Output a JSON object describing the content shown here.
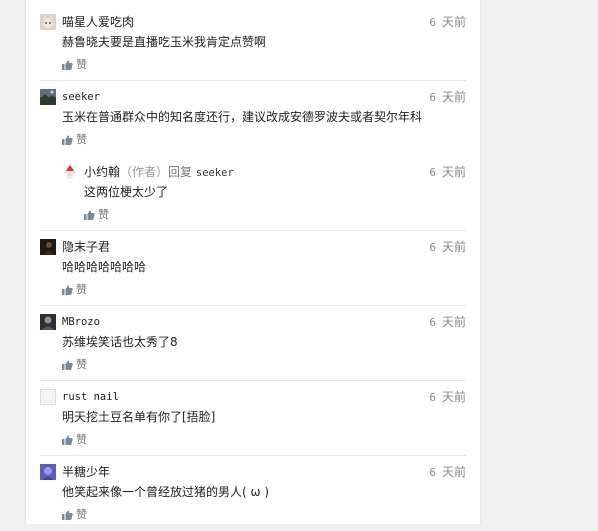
{
  "comments": [
    {
      "name": "喵星人爱吃肉",
      "time_num": "6",
      "time_unit": "天前",
      "text": "赫鲁晓夫要是直播吃玉米我肯定点赞啊",
      "like_label": "赞",
      "avatar_icon": "cat-avatar-icon"
    },
    {
      "name": "seeker",
      "time_num": "6",
      "time_unit": "天前",
      "text": "玉米在普通群众中的知名度还行，建议改成安德罗波夫或者契尔年科",
      "like_label": "赞",
      "avatar_icon": "landscape-avatar-icon"
    },
    {
      "name": "小约翰",
      "role": "（作者）",
      "reply_word": "回复",
      "reply_target": "seeker",
      "time_num": "6",
      "time_unit": "天前",
      "text": "这两位梗太少了",
      "like_label": "赞",
      "avatar_icon": "santa-avatar-icon"
    },
    {
      "name": "隐末子君",
      "time_num": "6",
      "time_unit": "天前",
      "text": "哈哈哈哈哈哈哈",
      "like_label": "赞",
      "avatar_icon": "dark-avatar-icon"
    },
    {
      "name": "MBrozo",
      "time_num": "6",
      "time_unit": "天前",
      "text": "苏维埃笑话也太秀了8",
      "like_label": "赞",
      "avatar_icon": "character-avatar-icon"
    },
    {
      "name": "rust nail",
      "time_num": "6",
      "time_unit": "天前",
      "text": "明天挖土豆名单有你了[捂脸]",
      "like_label": "赞",
      "avatar_icon": "blank-avatar-icon"
    },
    {
      "name": "半糖少年",
      "time_num": "6",
      "time_unit": "天前",
      "text": "他笑起来像一个曾经放过猪的男人(   ω   )",
      "like_label": "赞",
      "avatar_icon": "purple-avatar-icon"
    }
  ],
  "colors": {
    "background": "#f0f0f0",
    "panel": "#ffffff",
    "muted_text": "#888888",
    "divider": "#e8e8e8"
  }
}
